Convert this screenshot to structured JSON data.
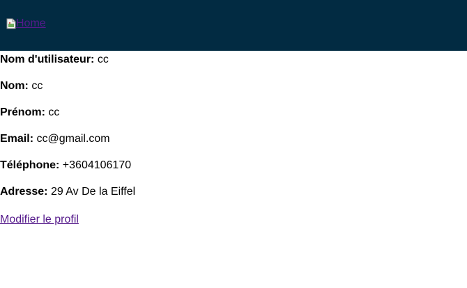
{
  "header": {
    "home_alt": "Home",
    "background": "#022b42",
    "home_icon": "broken-image-icon"
  },
  "profile": {
    "username": {
      "label": "Nom d'utilisateur:",
      "value": "cc"
    },
    "lastname": {
      "label": "Nom:",
      "value": "cc"
    },
    "firstname": {
      "label": "Prénom:",
      "value": "cc"
    },
    "email": {
      "label": "Email:",
      "value": "cc@gmail.com"
    },
    "phone": {
      "label": "Téléphone:",
      "value": "+3604106170"
    },
    "address": {
      "label": "Adresse:",
      "value": "29 Av De la Eiffel"
    }
  },
  "actions": {
    "edit_profile": "Modifier le profil"
  },
  "colors": {
    "link": "#551a8b"
  }
}
